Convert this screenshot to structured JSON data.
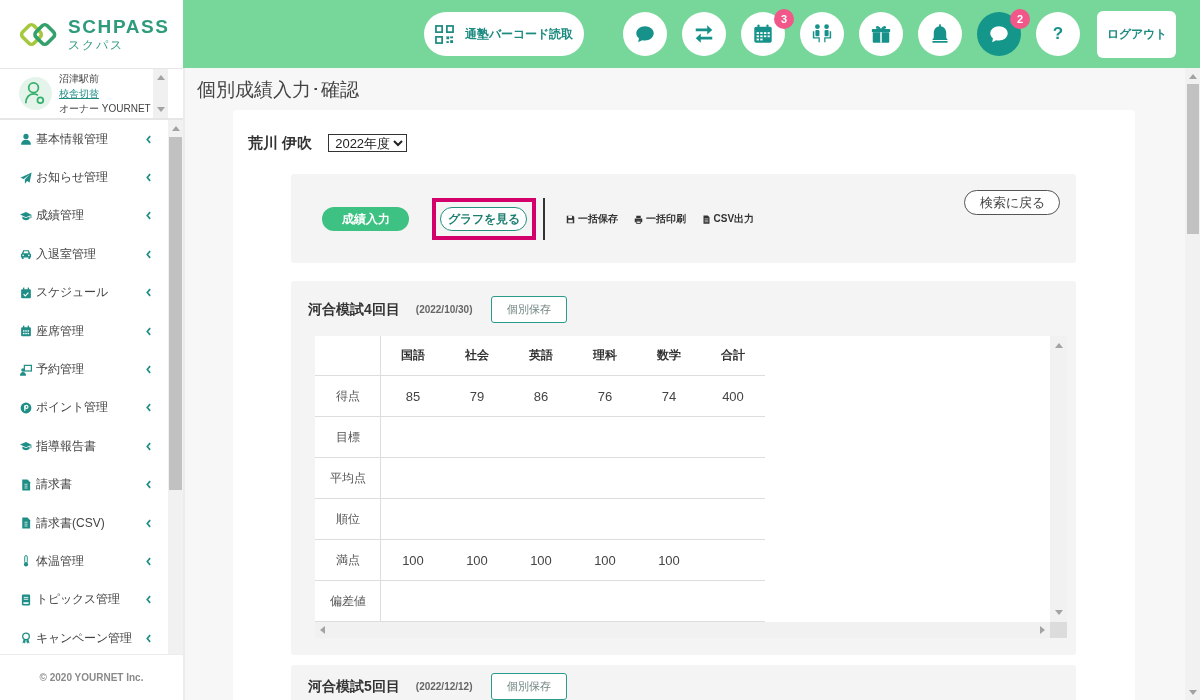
{
  "logo": {
    "name": "SCHPASS",
    "subtitle": "スクパス"
  },
  "header": {
    "barcode_button": "通塾バーコード読取",
    "icon_buttons": [
      {
        "selected": false
      },
      {
        "selected": false
      },
      {
        "selected": false,
        "badge": "3"
      },
      {
        "selected": false
      },
      {
        "selected": false
      },
      {
        "selected": false
      },
      {
        "selected": true,
        "badge": "2"
      },
      {
        "selected": false,
        "glyph": "?"
      }
    ],
    "logout_button": "ログアウト"
  },
  "sidebar": {
    "school": "沼津駅前",
    "switch_link": "校舎切替",
    "owner": "オーナー YOURNET",
    "items": [
      {
        "label": "基本情報管理",
        "expanded": false
      },
      {
        "label": "お知らせ管理",
        "expanded": false
      },
      {
        "label": "成績管理",
        "expanded": false
      },
      {
        "label": "入退室管理",
        "expanded": false
      },
      {
        "label": "スケジュール",
        "expanded": false
      },
      {
        "label": "座席管理",
        "expanded": false
      },
      {
        "label": "予約管理",
        "expanded": false
      },
      {
        "label": "ポイント管理",
        "expanded": false
      },
      {
        "label": "指導報告書",
        "expanded": false
      },
      {
        "label": "請求書",
        "expanded": false
      },
      {
        "label": "請求書(CSV)",
        "expanded": false
      },
      {
        "label": "体温管理",
        "expanded": false
      },
      {
        "label": "トピックス管理",
        "expanded": false
      },
      {
        "label": "キャンペーン管理",
        "expanded": false
      }
    ],
    "footer": "© 2020 YOURNET Inc."
  },
  "page": {
    "title": "個別成績入力･確認",
    "student": {
      "name": "荒川 伊吹",
      "year": "2022年度"
    },
    "toolbar": {
      "modes": [
        {
          "label": "成績入力",
          "selected": true,
          "highlighted": false
        },
        {
          "label": "グラフを見る",
          "selected": false,
          "highlighted": true
        }
      ],
      "actions": [
        "一括保存",
        "一括印刷",
        "CSV出力"
      ],
      "back_button": "検索に戻る"
    },
    "exams": [
      {
        "title": "河合模試4回目",
        "date": "(2022/10/30)",
        "save_button": "個別保存",
        "table": {
          "columns": [
            "国語",
            "社会",
            "英語",
            "理科",
            "数学",
            "合計"
          ],
          "rows": [
            {
              "label": "得点",
              "cells": [
                "85",
                "79",
                "86",
                "76",
                "74",
                "400"
              ]
            },
            {
              "label": "目標"
            },
            {
              "label": "平均点"
            },
            {
              "label": "順位"
            },
            {
              "label": "満点",
              "cells": [
                "100",
                "100",
                "100",
                "100",
                "100"
              ]
            },
            {
              "label": "偏差値"
            }
          ]
        }
      },
      {
        "title": "河合模試5回目",
        "date": "(2022/12/12)",
        "save_button": "個別保存"
      }
    ]
  }
}
